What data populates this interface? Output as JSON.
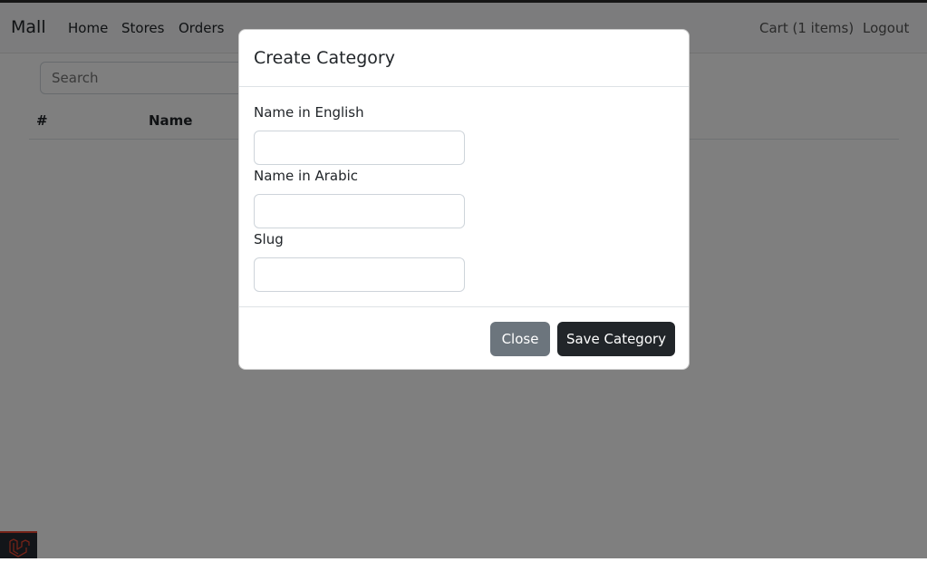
{
  "navbar": {
    "brand": "Mall",
    "links": [
      "Home",
      "Stores",
      "Orders"
    ],
    "cart": "Cart (1 items)",
    "logout": "Logout"
  },
  "toolbar": {
    "search_placeholder": "Search"
  },
  "table": {
    "headers": [
      "#",
      "Name"
    ]
  },
  "modal": {
    "title": "Create Category",
    "fields": [
      {
        "label": "Name in English",
        "value": ""
      },
      {
        "label": "Name in Arabic",
        "value": ""
      },
      {
        "label": "Slug",
        "value": ""
      }
    ],
    "close_label": "Close",
    "save_label": "Save Category"
  },
  "colors": {
    "backdrop": "rgba(0,0,0,0.5)",
    "secondary_button": "#6c757d",
    "dark_button": "#212529",
    "laravel_red": "#e74430"
  },
  "icons": {
    "footer_badge": "laravel-icon"
  }
}
